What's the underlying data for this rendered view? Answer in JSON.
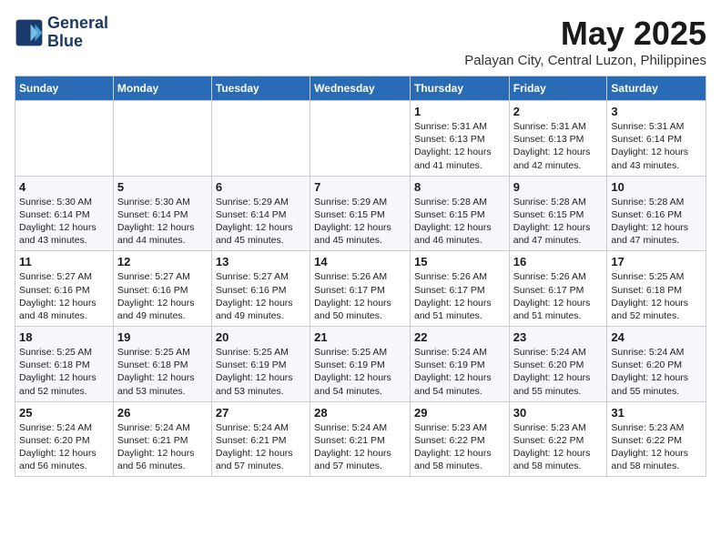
{
  "logo": {
    "text_line1": "General",
    "text_line2": "Blue"
  },
  "header": {
    "month": "May 2025",
    "location": "Palayan City, Central Luzon, Philippines"
  },
  "weekdays": [
    "Sunday",
    "Monday",
    "Tuesday",
    "Wednesday",
    "Thursday",
    "Friday",
    "Saturday"
  ],
  "weeks": [
    [
      {
        "day": "",
        "info": ""
      },
      {
        "day": "",
        "info": ""
      },
      {
        "day": "",
        "info": ""
      },
      {
        "day": "",
        "info": ""
      },
      {
        "day": "1",
        "info": "Sunrise: 5:31 AM\nSunset: 6:13 PM\nDaylight: 12 hours\nand 41 minutes."
      },
      {
        "day": "2",
        "info": "Sunrise: 5:31 AM\nSunset: 6:13 PM\nDaylight: 12 hours\nand 42 minutes."
      },
      {
        "day": "3",
        "info": "Sunrise: 5:31 AM\nSunset: 6:14 PM\nDaylight: 12 hours\nand 43 minutes."
      }
    ],
    [
      {
        "day": "4",
        "info": "Sunrise: 5:30 AM\nSunset: 6:14 PM\nDaylight: 12 hours\nand 43 minutes."
      },
      {
        "day": "5",
        "info": "Sunrise: 5:30 AM\nSunset: 6:14 PM\nDaylight: 12 hours\nand 44 minutes."
      },
      {
        "day": "6",
        "info": "Sunrise: 5:29 AM\nSunset: 6:14 PM\nDaylight: 12 hours\nand 45 minutes."
      },
      {
        "day": "7",
        "info": "Sunrise: 5:29 AM\nSunset: 6:15 PM\nDaylight: 12 hours\nand 45 minutes."
      },
      {
        "day": "8",
        "info": "Sunrise: 5:28 AM\nSunset: 6:15 PM\nDaylight: 12 hours\nand 46 minutes."
      },
      {
        "day": "9",
        "info": "Sunrise: 5:28 AM\nSunset: 6:15 PM\nDaylight: 12 hours\nand 47 minutes."
      },
      {
        "day": "10",
        "info": "Sunrise: 5:28 AM\nSunset: 6:16 PM\nDaylight: 12 hours\nand 47 minutes."
      }
    ],
    [
      {
        "day": "11",
        "info": "Sunrise: 5:27 AM\nSunset: 6:16 PM\nDaylight: 12 hours\nand 48 minutes."
      },
      {
        "day": "12",
        "info": "Sunrise: 5:27 AM\nSunset: 6:16 PM\nDaylight: 12 hours\nand 49 minutes."
      },
      {
        "day": "13",
        "info": "Sunrise: 5:27 AM\nSunset: 6:16 PM\nDaylight: 12 hours\nand 49 minutes."
      },
      {
        "day": "14",
        "info": "Sunrise: 5:26 AM\nSunset: 6:17 PM\nDaylight: 12 hours\nand 50 minutes."
      },
      {
        "day": "15",
        "info": "Sunrise: 5:26 AM\nSunset: 6:17 PM\nDaylight: 12 hours\nand 51 minutes."
      },
      {
        "day": "16",
        "info": "Sunrise: 5:26 AM\nSunset: 6:17 PM\nDaylight: 12 hours\nand 51 minutes."
      },
      {
        "day": "17",
        "info": "Sunrise: 5:25 AM\nSunset: 6:18 PM\nDaylight: 12 hours\nand 52 minutes."
      }
    ],
    [
      {
        "day": "18",
        "info": "Sunrise: 5:25 AM\nSunset: 6:18 PM\nDaylight: 12 hours\nand 52 minutes."
      },
      {
        "day": "19",
        "info": "Sunrise: 5:25 AM\nSunset: 6:18 PM\nDaylight: 12 hours\nand 53 minutes."
      },
      {
        "day": "20",
        "info": "Sunrise: 5:25 AM\nSunset: 6:19 PM\nDaylight: 12 hours\nand 53 minutes."
      },
      {
        "day": "21",
        "info": "Sunrise: 5:25 AM\nSunset: 6:19 PM\nDaylight: 12 hours\nand 54 minutes."
      },
      {
        "day": "22",
        "info": "Sunrise: 5:24 AM\nSunset: 6:19 PM\nDaylight: 12 hours\nand 54 minutes."
      },
      {
        "day": "23",
        "info": "Sunrise: 5:24 AM\nSunset: 6:20 PM\nDaylight: 12 hours\nand 55 minutes."
      },
      {
        "day": "24",
        "info": "Sunrise: 5:24 AM\nSunset: 6:20 PM\nDaylight: 12 hours\nand 55 minutes."
      }
    ],
    [
      {
        "day": "25",
        "info": "Sunrise: 5:24 AM\nSunset: 6:20 PM\nDaylight: 12 hours\nand 56 minutes."
      },
      {
        "day": "26",
        "info": "Sunrise: 5:24 AM\nSunset: 6:21 PM\nDaylight: 12 hours\nand 56 minutes."
      },
      {
        "day": "27",
        "info": "Sunrise: 5:24 AM\nSunset: 6:21 PM\nDaylight: 12 hours\nand 57 minutes."
      },
      {
        "day": "28",
        "info": "Sunrise: 5:24 AM\nSunset: 6:21 PM\nDaylight: 12 hours\nand 57 minutes."
      },
      {
        "day": "29",
        "info": "Sunrise: 5:23 AM\nSunset: 6:22 PM\nDaylight: 12 hours\nand 58 minutes."
      },
      {
        "day": "30",
        "info": "Sunrise: 5:23 AM\nSunset: 6:22 PM\nDaylight: 12 hours\nand 58 minutes."
      },
      {
        "day": "31",
        "info": "Sunrise: 5:23 AM\nSunset: 6:22 PM\nDaylight: 12 hours\nand 58 minutes."
      }
    ]
  ]
}
